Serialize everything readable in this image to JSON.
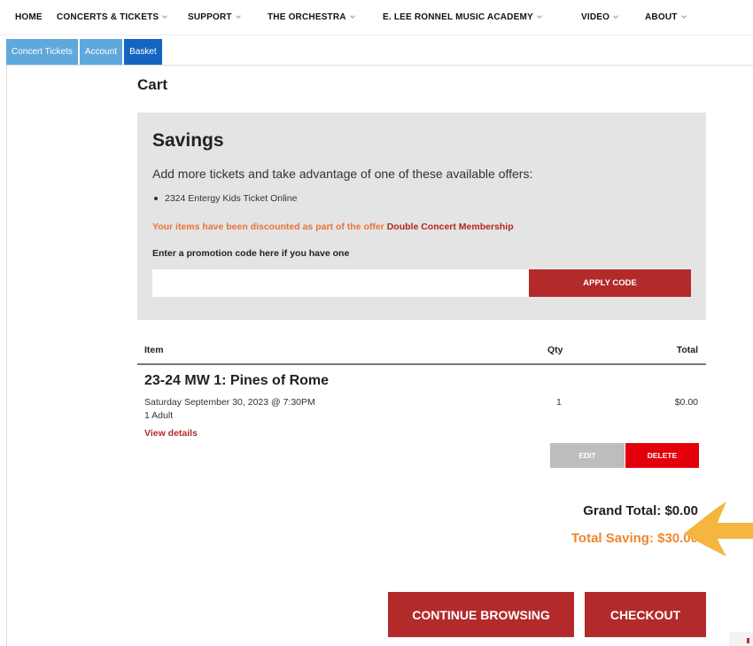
{
  "nav": {
    "items": [
      {
        "label": "HOME",
        "has_dropdown": false
      },
      {
        "label": "CONCERTS & TICKETS",
        "has_dropdown": true
      },
      {
        "label": "SUPPORT",
        "has_dropdown": true
      },
      {
        "label": "THE ORCHESTRA",
        "has_dropdown": true
      },
      {
        "label": "E. LEE RONNEL MUSIC ACADEMY",
        "has_dropdown": true
      },
      {
        "label": "VIDEO",
        "has_dropdown": true
      },
      {
        "label": "ABOUT",
        "has_dropdown": true
      }
    ]
  },
  "tabs": [
    {
      "label": "Concert Tickets",
      "active": false
    },
    {
      "label": "Account",
      "active": false
    },
    {
      "label": "Basket",
      "active": true
    }
  ],
  "cart": {
    "title": "Cart"
  },
  "savings": {
    "title": "Savings",
    "lead": "Add more tickets and take advantage of one of these available offers:",
    "offers": [
      "2324 Entergy Kids Ticket Online"
    ],
    "discount_text": "Your items have been discounted as part of the offer",
    "discount_offer": "Double Concert Membership",
    "promo_label": "Enter a promotion code here if you have one",
    "promo_value": "",
    "apply_label": "APPLY CODE"
  },
  "table": {
    "headers": {
      "item": "Item",
      "qty": "Qty",
      "total": "Total"
    },
    "rows": [
      {
        "title": "23-24 MW 1: Pines of Rome",
        "date": "Saturday September 30, 2023 @ 7:30PM",
        "ticket": "1 Adult",
        "details_link": "View details",
        "qty": "1",
        "total": "$0.00",
        "edit_label": "EDIT",
        "delete_label": "DELETE"
      }
    ]
  },
  "totals": {
    "grand_label": "Grand Total:",
    "grand_value": "$0.00",
    "saving_label": "Total Saving:",
    "saving_value": "$30.00"
  },
  "actions": {
    "continue_label": "CONTINUE BROWSING",
    "checkout_label": "CHECKOUT"
  },
  "colors": {
    "brand_red": "#b22a2a",
    "delete_red": "#e3000b",
    "tab_active": "#1565c0",
    "tab_inactive": "#5fa8dc",
    "saving_orange": "#f0862e",
    "annotation_arrow": "#f4b63f"
  },
  "icons": {
    "dropdown": "chevron-down-icon",
    "annotation": "arrow-left-icon"
  }
}
